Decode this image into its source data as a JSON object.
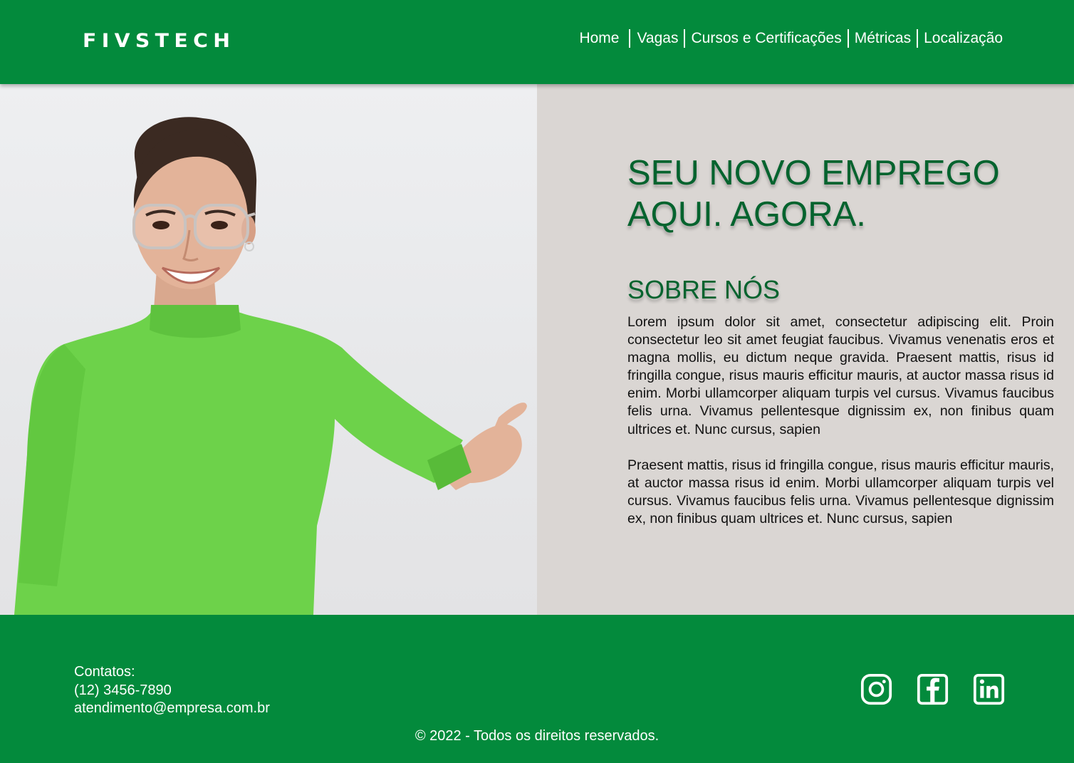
{
  "header": {
    "logo": "FIVSTECH",
    "nav": [
      {
        "label": "Home"
      },
      {
        "label": "Vagas"
      },
      {
        "label": "Cursos e Certificações"
      },
      {
        "label": "Métricas"
      },
      {
        "label": "Localização"
      }
    ]
  },
  "hero": {
    "headline_line1": "SEU NOVO EMPREGO",
    "headline_line2": "AQUI. AGORA.",
    "about_title": "SOBRE NÓS",
    "about_paragraph1": "Lorem ipsum dolor sit amet, consectetur adipiscing elit. Proin consectetur leo sit amet feugiat faucibus. Vivamus venenatis eros et magna mollis, eu dictum neque gravida. Praesent mattis, risus id fringilla congue, risus mauris efficitur mauris, at auctor massa risus id enim. Morbi ullamcorper aliquam turpis vel cursus. Vivamus faucibus felis urna. Vivamus pellentesque dignissim ex, non finibus quam ultrices et. Nunc cursus, sapien",
    "about_paragraph2": "Praesent mattis, risus id fringilla congue, risus mauris efficitur mauris, at auctor massa risus id enim. Morbi ullamcorper aliquam turpis vel cursus. Vivamus faucibus felis urna. Vivamus pellentesque dignissim ex, non finibus quam ultrices et. Nunc cursus, sapien"
  },
  "footer": {
    "contacts_label": "Contatos:",
    "phone": "(12) 3456-7890",
    "email": "atendimento@empresa.com.br",
    "social": [
      "instagram-icon",
      "facebook-icon",
      "linkedin-icon"
    ],
    "copyright": "© 2022 - Todos os direitos reservados."
  },
  "colors": {
    "brand_green": "#038a3c",
    "headline_green": "#04632e",
    "content_bg": "#dad6d3",
    "sweater_green": "#6dd24a"
  }
}
